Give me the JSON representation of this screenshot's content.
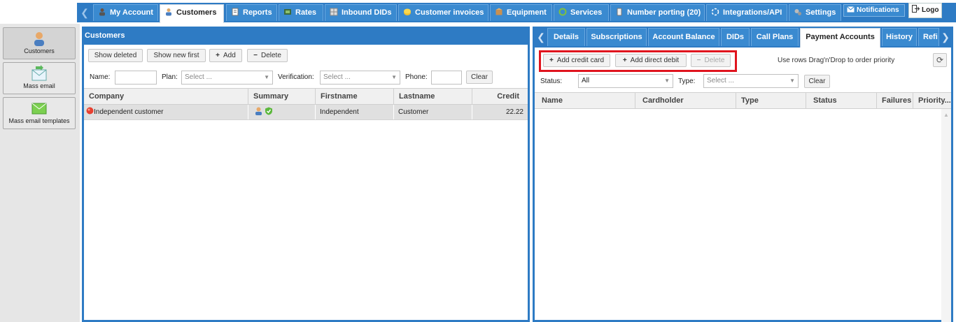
{
  "nav": {
    "prev_arrow": "❮",
    "tabs": [
      {
        "label": "My Account",
        "icon": "person-key-icon"
      },
      {
        "label": "Customers",
        "icon": "user-icon"
      },
      {
        "label": "Reports",
        "icon": "report-icon"
      },
      {
        "label": "Rates",
        "icon": "rates-icon"
      },
      {
        "label": "Inbound DIDs",
        "icon": "grid-icon"
      },
      {
        "label": "Customer invoices",
        "icon": "coins-icon"
      },
      {
        "label": "Equipment",
        "icon": "box-icon"
      },
      {
        "label": "Services",
        "icon": "refresh-icon"
      },
      {
        "label": "Number porting (20)",
        "icon": "phone-icon"
      },
      {
        "label": "Integrations/API",
        "icon": "plug-icon"
      },
      {
        "label": "Settings",
        "icon": "gears-icon"
      }
    ],
    "notifications_label": "Notifications",
    "logout_label": "Logo"
  },
  "sidebar": {
    "items": [
      {
        "label": "Customers",
        "icon": "customer-icon"
      },
      {
        "label": "Mass email",
        "icon": "mass-email-icon"
      },
      {
        "label": "Mass email templates",
        "icon": "email-template-icon"
      }
    ]
  },
  "customers": {
    "title": "Customers",
    "toolbar": {
      "show_deleted": "Show deleted",
      "show_new_first": "Show new first",
      "add": "Add",
      "delete": "Delete"
    },
    "filters": {
      "name_label": "Name:",
      "plan_label": "Plan:",
      "plan_placeholder": "Select ...",
      "verification_label": "Verification:",
      "verification_placeholder": "Select ...",
      "phone_label": "Phone:",
      "clear": "Clear"
    },
    "columns": [
      "Company",
      "Summary",
      "Firstname",
      "Lastname",
      "Credit"
    ],
    "rows": [
      {
        "company": "Independent customer",
        "firstname": "Independent",
        "lastname": "Customer",
        "credit": "22.22"
      }
    ]
  },
  "details": {
    "tabs": [
      "Details",
      "Subscriptions",
      "Account Balance",
      "DIDs",
      "Call Plans",
      "Payment Accounts",
      "History",
      "Refi"
    ],
    "active_tab": "Payment Accounts",
    "toolbar": {
      "add_credit_card": "Add credit card",
      "add_direct_debit": "Add direct debit",
      "delete": "Delete"
    },
    "hint": "Use rows Drag'n'Drop to order priority",
    "filters": {
      "status_label": "Status:",
      "status_value": "All",
      "type_label": "Type:",
      "type_placeholder": "Select ...",
      "clear": "Clear"
    },
    "columns": [
      "Name",
      "Cardholder",
      "Type",
      "Status",
      "Failures",
      "Priority..."
    ]
  },
  "colors": {
    "brand_blue": "#2e7bc4",
    "highlight_red": "#e0141e"
  }
}
